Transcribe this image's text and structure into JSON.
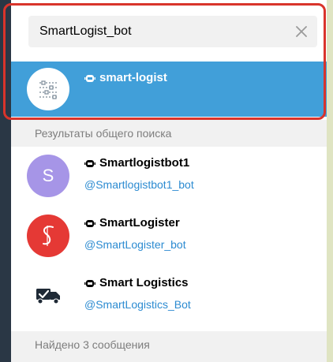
{
  "search": {
    "value": "SmartLogist_bot"
  },
  "top_result": {
    "title": "smart-logist"
  },
  "sections": {
    "global_search": "Результаты общего поиска",
    "found_messages": "Найдено 3 сообщения"
  },
  "results": [
    {
      "title": "Smartlogistbot1",
      "username": "@Smartlogistbot1_bot",
      "avatar_letter": "S",
      "avatar_color": "#a695e7"
    },
    {
      "title": "SmartLogister",
      "username": "@SmartLogister_bot",
      "avatar_color": "#e53935"
    },
    {
      "title": "Smart Logistics",
      "username": "@SmartLogistics_Bot"
    }
  ],
  "colors": {
    "highlight": "#419fd9",
    "link": "#2c8bd1",
    "frame": "#d9342b"
  }
}
